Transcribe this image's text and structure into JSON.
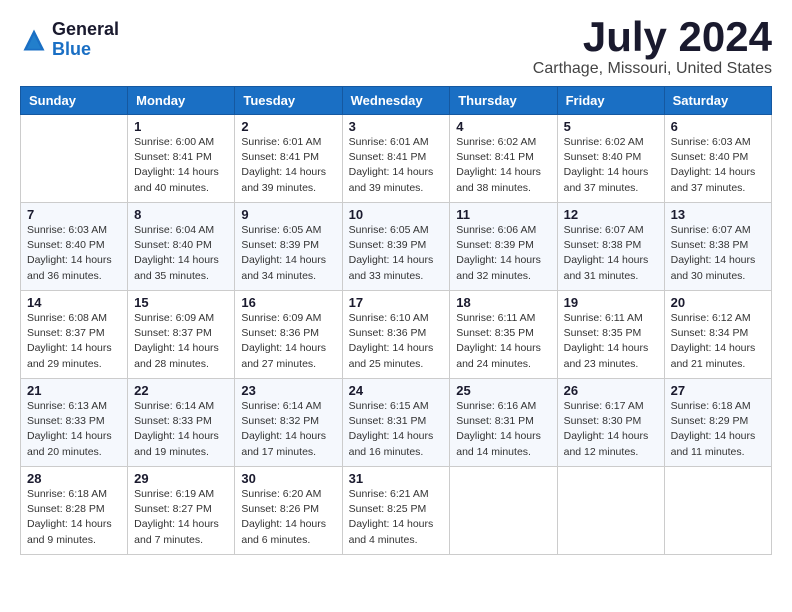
{
  "logo": {
    "general": "General",
    "blue": "Blue"
  },
  "title": "July 2024",
  "location": "Carthage, Missouri, United States",
  "days_of_week": [
    "Sunday",
    "Monday",
    "Tuesday",
    "Wednesday",
    "Thursday",
    "Friday",
    "Saturday"
  ],
  "weeks": [
    [
      {
        "day": "",
        "sunrise": "",
        "sunset": "",
        "daylight": ""
      },
      {
        "day": "1",
        "sunrise": "Sunrise: 6:00 AM",
        "sunset": "Sunset: 8:41 PM",
        "daylight": "Daylight: 14 hours and 40 minutes."
      },
      {
        "day": "2",
        "sunrise": "Sunrise: 6:01 AM",
        "sunset": "Sunset: 8:41 PM",
        "daylight": "Daylight: 14 hours and 39 minutes."
      },
      {
        "day": "3",
        "sunrise": "Sunrise: 6:01 AM",
        "sunset": "Sunset: 8:41 PM",
        "daylight": "Daylight: 14 hours and 39 minutes."
      },
      {
        "day": "4",
        "sunrise": "Sunrise: 6:02 AM",
        "sunset": "Sunset: 8:41 PM",
        "daylight": "Daylight: 14 hours and 38 minutes."
      },
      {
        "day": "5",
        "sunrise": "Sunrise: 6:02 AM",
        "sunset": "Sunset: 8:40 PM",
        "daylight": "Daylight: 14 hours and 37 minutes."
      },
      {
        "day": "6",
        "sunrise": "Sunrise: 6:03 AM",
        "sunset": "Sunset: 8:40 PM",
        "daylight": "Daylight: 14 hours and 37 minutes."
      }
    ],
    [
      {
        "day": "7",
        "sunrise": "Sunrise: 6:03 AM",
        "sunset": "Sunset: 8:40 PM",
        "daylight": "Daylight: 14 hours and 36 minutes."
      },
      {
        "day": "8",
        "sunrise": "Sunrise: 6:04 AM",
        "sunset": "Sunset: 8:40 PM",
        "daylight": "Daylight: 14 hours and 35 minutes."
      },
      {
        "day": "9",
        "sunrise": "Sunrise: 6:05 AM",
        "sunset": "Sunset: 8:39 PM",
        "daylight": "Daylight: 14 hours and 34 minutes."
      },
      {
        "day": "10",
        "sunrise": "Sunrise: 6:05 AM",
        "sunset": "Sunset: 8:39 PM",
        "daylight": "Daylight: 14 hours and 33 minutes."
      },
      {
        "day": "11",
        "sunrise": "Sunrise: 6:06 AM",
        "sunset": "Sunset: 8:39 PM",
        "daylight": "Daylight: 14 hours and 32 minutes."
      },
      {
        "day": "12",
        "sunrise": "Sunrise: 6:07 AM",
        "sunset": "Sunset: 8:38 PM",
        "daylight": "Daylight: 14 hours and 31 minutes."
      },
      {
        "day": "13",
        "sunrise": "Sunrise: 6:07 AM",
        "sunset": "Sunset: 8:38 PM",
        "daylight": "Daylight: 14 hours and 30 minutes."
      }
    ],
    [
      {
        "day": "14",
        "sunrise": "Sunrise: 6:08 AM",
        "sunset": "Sunset: 8:37 PM",
        "daylight": "Daylight: 14 hours and 29 minutes."
      },
      {
        "day": "15",
        "sunrise": "Sunrise: 6:09 AM",
        "sunset": "Sunset: 8:37 PM",
        "daylight": "Daylight: 14 hours and 28 minutes."
      },
      {
        "day": "16",
        "sunrise": "Sunrise: 6:09 AM",
        "sunset": "Sunset: 8:36 PM",
        "daylight": "Daylight: 14 hours and 27 minutes."
      },
      {
        "day": "17",
        "sunrise": "Sunrise: 6:10 AM",
        "sunset": "Sunset: 8:36 PM",
        "daylight": "Daylight: 14 hours and 25 minutes."
      },
      {
        "day": "18",
        "sunrise": "Sunrise: 6:11 AM",
        "sunset": "Sunset: 8:35 PM",
        "daylight": "Daylight: 14 hours and 24 minutes."
      },
      {
        "day": "19",
        "sunrise": "Sunrise: 6:11 AM",
        "sunset": "Sunset: 8:35 PM",
        "daylight": "Daylight: 14 hours and 23 minutes."
      },
      {
        "day": "20",
        "sunrise": "Sunrise: 6:12 AM",
        "sunset": "Sunset: 8:34 PM",
        "daylight": "Daylight: 14 hours and 21 minutes."
      }
    ],
    [
      {
        "day": "21",
        "sunrise": "Sunrise: 6:13 AM",
        "sunset": "Sunset: 8:33 PM",
        "daylight": "Daylight: 14 hours and 20 minutes."
      },
      {
        "day": "22",
        "sunrise": "Sunrise: 6:14 AM",
        "sunset": "Sunset: 8:33 PM",
        "daylight": "Daylight: 14 hours and 19 minutes."
      },
      {
        "day": "23",
        "sunrise": "Sunrise: 6:14 AM",
        "sunset": "Sunset: 8:32 PM",
        "daylight": "Daylight: 14 hours and 17 minutes."
      },
      {
        "day": "24",
        "sunrise": "Sunrise: 6:15 AM",
        "sunset": "Sunset: 8:31 PM",
        "daylight": "Daylight: 14 hours and 16 minutes."
      },
      {
        "day": "25",
        "sunrise": "Sunrise: 6:16 AM",
        "sunset": "Sunset: 8:31 PM",
        "daylight": "Daylight: 14 hours and 14 minutes."
      },
      {
        "day": "26",
        "sunrise": "Sunrise: 6:17 AM",
        "sunset": "Sunset: 8:30 PM",
        "daylight": "Daylight: 14 hours and 12 minutes."
      },
      {
        "day": "27",
        "sunrise": "Sunrise: 6:18 AM",
        "sunset": "Sunset: 8:29 PM",
        "daylight": "Daylight: 14 hours and 11 minutes."
      }
    ],
    [
      {
        "day": "28",
        "sunrise": "Sunrise: 6:18 AM",
        "sunset": "Sunset: 8:28 PM",
        "daylight": "Daylight: 14 hours and 9 minutes."
      },
      {
        "day": "29",
        "sunrise": "Sunrise: 6:19 AM",
        "sunset": "Sunset: 8:27 PM",
        "daylight": "Daylight: 14 hours and 7 minutes."
      },
      {
        "day": "30",
        "sunrise": "Sunrise: 6:20 AM",
        "sunset": "Sunset: 8:26 PM",
        "daylight": "Daylight: 14 hours and 6 minutes."
      },
      {
        "day": "31",
        "sunrise": "Sunrise: 6:21 AM",
        "sunset": "Sunset: 8:25 PM",
        "daylight": "Daylight: 14 hours and 4 minutes."
      },
      {
        "day": "",
        "sunrise": "",
        "sunset": "",
        "daylight": ""
      },
      {
        "day": "",
        "sunrise": "",
        "sunset": "",
        "daylight": ""
      },
      {
        "day": "",
        "sunrise": "",
        "sunset": "",
        "daylight": ""
      }
    ]
  ]
}
